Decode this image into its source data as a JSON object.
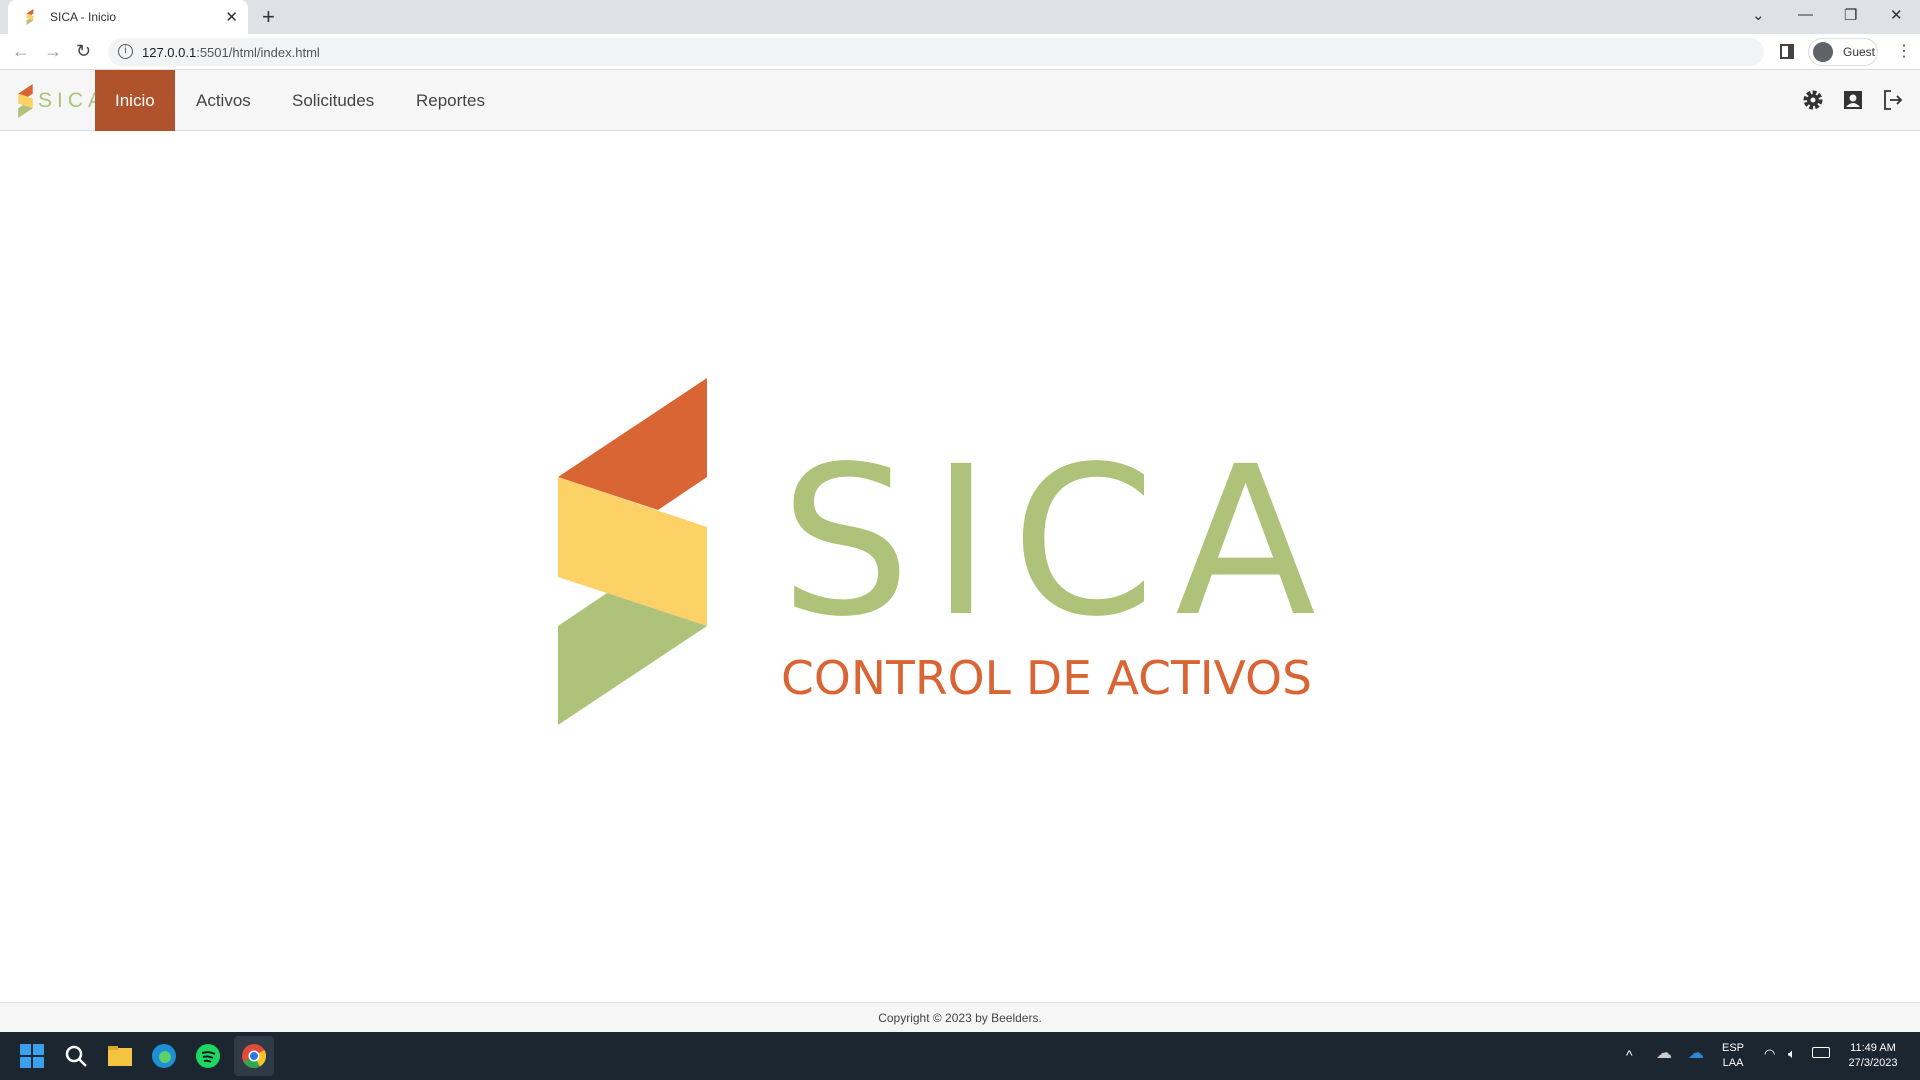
{
  "browser": {
    "tab_title": "SICA - Inicio",
    "url_host": "127.0.0.1",
    "url_rest": ":5501/html/index.html",
    "profile": "Guest"
  },
  "nav": {
    "brand": "SICA",
    "items": [
      {
        "label": "Inicio",
        "active": true
      },
      {
        "label": "Activos"
      },
      {
        "label": "Solicitudes"
      },
      {
        "label": "Reportes"
      }
    ]
  },
  "hero": {
    "title": "SICA",
    "subtitle": "CONTROL DE ACTIVOS"
  },
  "footer": {
    "text": "Copyright © 2023 by Beelders."
  },
  "taskbar": {
    "lang1": "ESP",
    "lang2": "LAA",
    "time": "11:49 AM",
    "date": "27/3/2023"
  },
  "colors": {
    "green": "#AFC27A",
    "orange": "#D86533",
    "yellow": "#FCD166",
    "active": "#B0522B"
  }
}
